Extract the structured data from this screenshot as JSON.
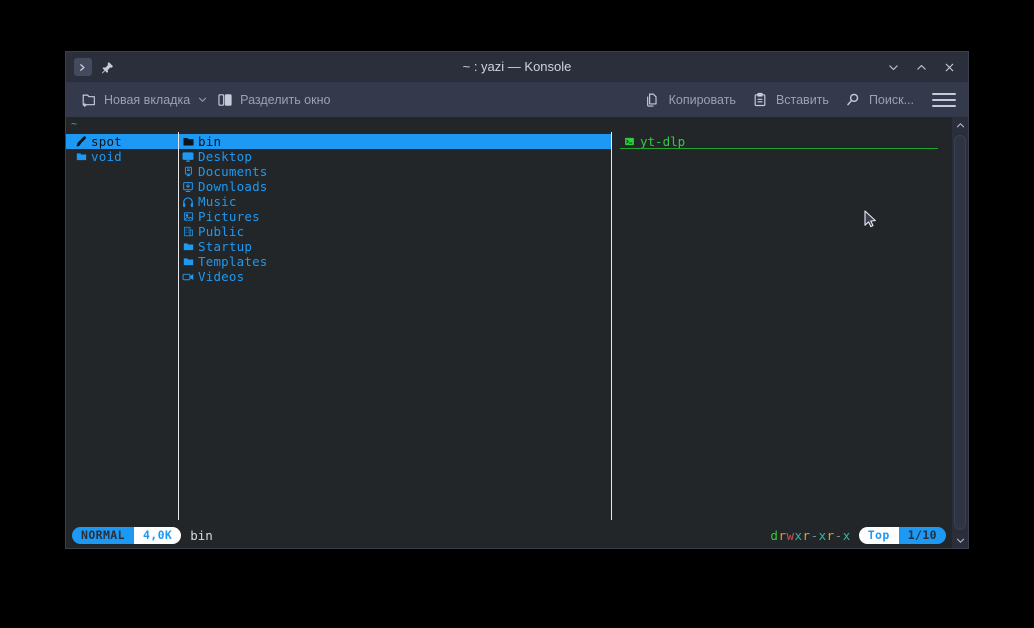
{
  "window": {
    "title": "~ : yazi — Konsole",
    "app_icon": "terminal-icon",
    "pin_icon": "pin-icon",
    "controls": [
      {
        "name": "minimize-button",
        "glyph": "⌄"
      },
      {
        "name": "maximize-button",
        "glyph": "⌃"
      },
      {
        "name": "close-button",
        "glyph": "✕"
      }
    ]
  },
  "toolbar": {
    "new_tab_label": "Новая вкладка",
    "split_view_label": "Разделить окно",
    "copy_label": "Копировать",
    "paste_label": "Вставить",
    "find_label": "Поиск...",
    "menu_icon": "hamburger-menu-icon"
  },
  "terminal": {
    "tab_label": "~",
    "parent_pane": {
      "items": [
        {
          "label": "spot",
          "icon": "brush-icon",
          "selected": true
        },
        {
          "label": "void",
          "icon": "folder-icon",
          "selected": false
        }
      ]
    },
    "current_pane": {
      "items": [
        {
          "label": "bin",
          "icon": "folder-icon",
          "selected": true
        },
        {
          "label": "Desktop",
          "icon": "monitor-icon",
          "selected": false
        },
        {
          "label": "Documents",
          "icon": "document-icon",
          "selected": false
        },
        {
          "label": "Downloads",
          "icon": "download-icon",
          "selected": false
        },
        {
          "label": "Music",
          "icon": "headphones-icon",
          "selected": false
        },
        {
          "label": "Pictures",
          "icon": "image-icon",
          "selected": false
        },
        {
          "label": "Public",
          "icon": "building-icon",
          "selected": false
        },
        {
          "label": "Startup",
          "icon": "folder-icon",
          "selected": false
        },
        {
          "label": "Templates",
          "icon": "folder-icon",
          "selected": false
        },
        {
          "label": "Videos",
          "icon": "video-icon",
          "selected": false
        }
      ]
    },
    "preview_pane": {
      "items": [
        {
          "label": "yt-dlp",
          "icon": "executable-icon"
        }
      ]
    }
  },
  "status": {
    "mode": "NORMAL",
    "size": "4,0K",
    "filename": "bin",
    "permissions": "drwxr-xr-x",
    "scroll_position": "Top",
    "counter": "1/10"
  },
  "colors": {
    "accent_blue": "#1d99f3",
    "terminal_bg": "#232628",
    "window_bg": "#2a2e3b",
    "toolbar_bg": "#343a4c",
    "preview_green": "#2ecc40"
  }
}
